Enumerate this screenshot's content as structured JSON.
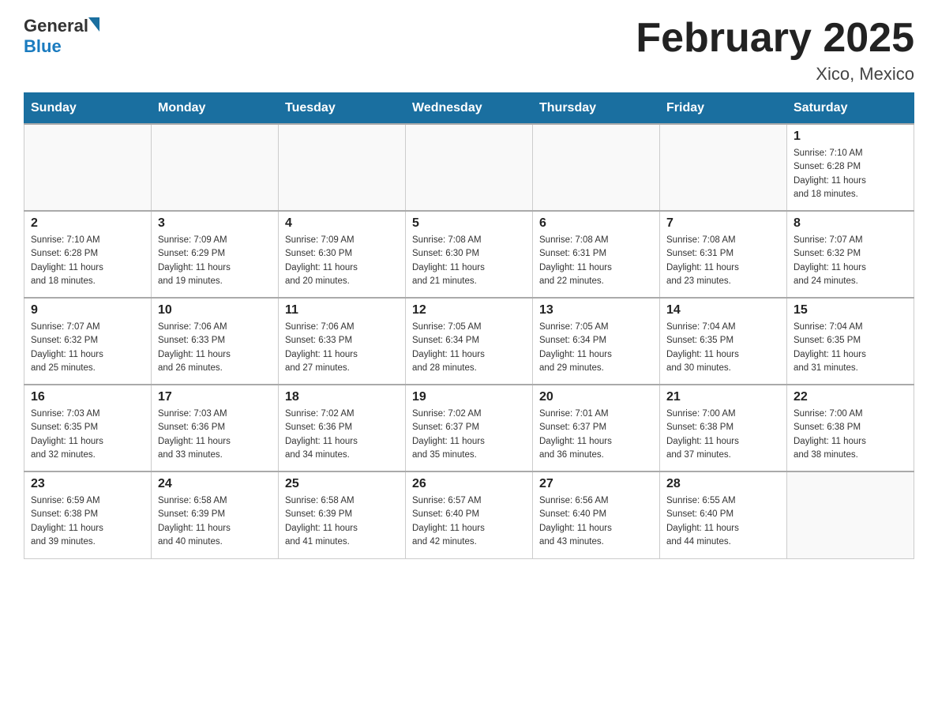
{
  "header": {
    "logo": {
      "general": "General",
      "blue": "Blue"
    },
    "title": "February 2025",
    "location": "Xico, Mexico"
  },
  "days_of_week": [
    "Sunday",
    "Monday",
    "Tuesday",
    "Wednesday",
    "Thursday",
    "Friday",
    "Saturday"
  ],
  "weeks": [
    [
      {
        "day": "",
        "info": ""
      },
      {
        "day": "",
        "info": ""
      },
      {
        "day": "",
        "info": ""
      },
      {
        "day": "",
        "info": ""
      },
      {
        "day": "",
        "info": ""
      },
      {
        "day": "",
        "info": ""
      },
      {
        "day": "1",
        "info": "Sunrise: 7:10 AM\nSunset: 6:28 PM\nDaylight: 11 hours\nand 18 minutes."
      }
    ],
    [
      {
        "day": "2",
        "info": "Sunrise: 7:10 AM\nSunset: 6:28 PM\nDaylight: 11 hours\nand 18 minutes."
      },
      {
        "day": "3",
        "info": "Sunrise: 7:09 AM\nSunset: 6:29 PM\nDaylight: 11 hours\nand 19 minutes."
      },
      {
        "day": "4",
        "info": "Sunrise: 7:09 AM\nSunset: 6:30 PM\nDaylight: 11 hours\nand 20 minutes."
      },
      {
        "day": "5",
        "info": "Sunrise: 7:08 AM\nSunset: 6:30 PM\nDaylight: 11 hours\nand 21 minutes."
      },
      {
        "day": "6",
        "info": "Sunrise: 7:08 AM\nSunset: 6:31 PM\nDaylight: 11 hours\nand 22 minutes."
      },
      {
        "day": "7",
        "info": "Sunrise: 7:08 AM\nSunset: 6:31 PM\nDaylight: 11 hours\nand 23 minutes."
      },
      {
        "day": "8",
        "info": "Sunrise: 7:07 AM\nSunset: 6:32 PM\nDaylight: 11 hours\nand 24 minutes."
      }
    ],
    [
      {
        "day": "9",
        "info": "Sunrise: 7:07 AM\nSunset: 6:32 PM\nDaylight: 11 hours\nand 25 minutes."
      },
      {
        "day": "10",
        "info": "Sunrise: 7:06 AM\nSunset: 6:33 PM\nDaylight: 11 hours\nand 26 minutes."
      },
      {
        "day": "11",
        "info": "Sunrise: 7:06 AM\nSunset: 6:33 PM\nDaylight: 11 hours\nand 27 minutes."
      },
      {
        "day": "12",
        "info": "Sunrise: 7:05 AM\nSunset: 6:34 PM\nDaylight: 11 hours\nand 28 minutes."
      },
      {
        "day": "13",
        "info": "Sunrise: 7:05 AM\nSunset: 6:34 PM\nDaylight: 11 hours\nand 29 minutes."
      },
      {
        "day": "14",
        "info": "Sunrise: 7:04 AM\nSunset: 6:35 PM\nDaylight: 11 hours\nand 30 minutes."
      },
      {
        "day": "15",
        "info": "Sunrise: 7:04 AM\nSunset: 6:35 PM\nDaylight: 11 hours\nand 31 minutes."
      }
    ],
    [
      {
        "day": "16",
        "info": "Sunrise: 7:03 AM\nSunset: 6:35 PM\nDaylight: 11 hours\nand 32 minutes."
      },
      {
        "day": "17",
        "info": "Sunrise: 7:03 AM\nSunset: 6:36 PM\nDaylight: 11 hours\nand 33 minutes."
      },
      {
        "day": "18",
        "info": "Sunrise: 7:02 AM\nSunset: 6:36 PM\nDaylight: 11 hours\nand 34 minutes."
      },
      {
        "day": "19",
        "info": "Sunrise: 7:02 AM\nSunset: 6:37 PM\nDaylight: 11 hours\nand 35 minutes."
      },
      {
        "day": "20",
        "info": "Sunrise: 7:01 AM\nSunset: 6:37 PM\nDaylight: 11 hours\nand 36 minutes."
      },
      {
        "day": "21",
        "info": "Sunrise: 7:00 AM\nSunset: 6:38 PM\nDaylight: 11 hours\nand 37 minutes."
      },
      {
        "day": "22",
        "info": "Sunrise: 7:00 AM\nSunset: 6:38 PM\nDaylight: 11 hours\nand 38 minutes."
      }
    ],
    [
      {
        "day": "23",
        "info": "Sunrise: 6:59 AM\nSunset: 6:38 PM\nDaylight: 11 hours\nand 39 minutes."
      },
      {
        "day": "24",
        "info": "Sunrise: 6:58 AM\nSunset: 6:39 PM\nDaylight: 11 hours\nand 40 minutes."
      },
      {
        "day": "25",
        "info": "Sunrise: 6:58 AM\nSunset: 6:39 PM\nDaylight: 11 hours\nand 41 minutes."
      },
      {
        "day": "26",
        "info": "Sunrise: 6:57 AM\nSunset: 6:40 PM\nDaylight: 11 hours\nand 42 minutes."
      },
      {
        "day": "27",
        "info": "Sunrise: 6:56 AM\nSunset: 6:40 PM\nDaylight: 11 hours\nand 43 minutes."
      },
      {
        "day": "28",
        "info": "Sunrise: 6:55 AM\nSunset: 6:40 PM\nDaylight: 11 hours\nand 44 minutes."
      },
      {
        "day": "",
        "info": ""
      }
    ]
  ]
}
